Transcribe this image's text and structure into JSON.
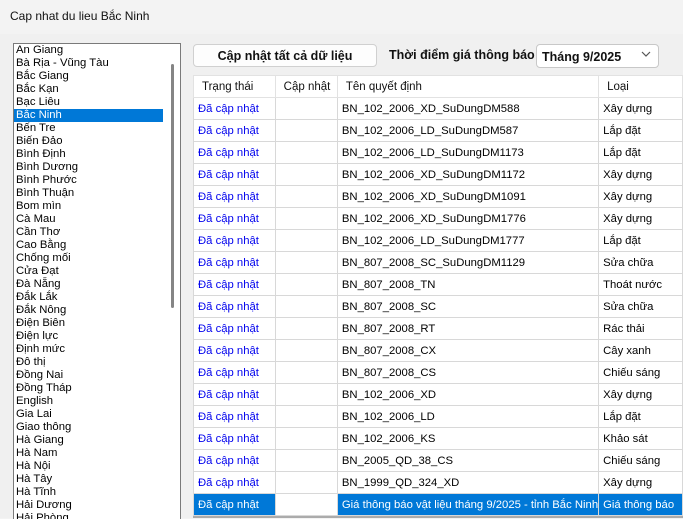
{
  "window": {
    "title": "Cap nhat du lieu Bắc Ninh"
  },
  "provinces": {
    "selected_index": 5,
    "items": [
      "An Giang",
      "Bà Rịa - Vũng Tàu",
      "Bắc Giang",
      "Bắc Kạn",
      "Bạc Liêu",
      "Bắc Ninh",
      "Bến Tre",
      "Biến Đảo",
      "Bình Định",
      "Bình Dương",
      "Bình Phước",
      "Bình Thuận",
      "Bom mìn",
      "Cà Mau",
      "Cần Thơ",
      "Cao Bằng",
      "Chống mối",
      "Cửa Đạt",
      "Đà Nẵng",
      "Đắk Lắk",
      "Đắk Nông",
      "Điện Biên",
      "Điện lực",
      "Định mức",
      "Đô thị",
      "Đồng Nai",
      "Đồng Tháp",
      "English",
      "Gia Lai",
      "Giao thông",
      "Hà Giang",
      "Hà Nam",
      "Hà Nội",
      "Hà Tây",
      "Hà Tĩnh",
      "Hải Dương",
      "Hải Phòng"
    ]
  },
  "toolbar": {
    "update_all_label": "Cập nhật tất cả dữ liệu",
    "notify_label": "Thời điểm giá thông báo",
    "month_value": "Tháng 9/2025"
  },
  "grid": {
    "columns": [
      "Trạng thái",
      "Cập nhật",
      "Tên quyết định",
      "Loại"
    ],
    "selected_row": 18,
    "rows": [
      {
        "status": "Đã cập nhật",
        "update": "",
        "name": "BN_102_2006_XD_SuDungDM588",
        "type": "Xây dựng"
      },
      {
        "status": "Đã cập nhật",
        "update": "",
        "name": "BN_102_2006_LD_SuDungDM587",
        "type": "Lắp đặt"
      },
      {
        "status": "Đã cập nhật",
        "update": "",
        "name": "BN_102_2006_LD_SuDungDM1173",
        "type": "Lắp đặt"
      },
      {
        "status": "Đã cập nhật",
        "update": "",
        "name": "BN_102_2006_XD_SuDungDM1172",
        "type": "Xây dựng"
      },
      {
        "status": "Đã cập nhật",
        "update": "",
        "name": "BN_102_2006_XD_SuDungDM1091",
        "type": "Xây dựng"
      },
      {
        "status": "Đã cập nhật",
        "update": "",
        "name": "BN_102_2006_XD_SuDungDM1776",
        "type": "Xây dựng"
      },
      {
        "status": "Đã cập nhật",
        "update": "",
        "name": "BN_102_2006_LD_SuDungDM1777",
        "type": "Lắp đặt"
      },
      {
        "status": "Đã cập nhật",
        "update": "",
        "name": "BN_807_2008_SC_SuDungDM1129",
        "type": "Sửa chữa"
      },
      {
        "status": "Đã cập nhật",
        "update": "",
        "name": "BN_807_2008_TN",
        "type": "Thoát nước"
      },
      {
        "status": "Đã cập nhật",
        "update": "",
        "name": "BN_807_2008_SC",
        "type": "Sửa chữa"
      },
      {
        "status": "Đã cập nhật",
        "update": "",
        "name": "BN_807_2008_RT",
        "type": "Rác thải"
      },
      {
        "status": "Đã cập nhật",
        "update": "",
        "name": "BN_807_2008_CX",
        "type": "Cây xanh"
      },
      {
        "status": "Đã cập nhật",
        "update": "",
        "name": "BN_807_2008_CS",
        "type": "Chiếu sáng"
      },
      {
        "status": "Đã cập nhật",
        "update": "",
        "name": "BN_102_2006_XD",
        "type": "Xây dựng"
      },
      {
        "status": "Đã cập nhật",
        "update": "",
        "name": "BN_102_2006_LD",
        "type": "Lắp đặt"
      },
      {
        "status": "Đã cập nhật",
        "update": "",
        "name": "BN_102_2006_KS",
        "type": "Khảo sát"
      },
      {
        "status": "Đã cập nhật",
        "update": "",
        "name": "BN_2005_QD_38_CS",
        "type": "Chiếu sáng"
      },
      {
        "status": "Đã cập nhật",
        "update": "",
        "name": "BN_1999_QD_324_XD",
        "type": "Xây dựng"
      },
      {
        "status": "Đã cập nhật",
        "update": "",
        "name": "Giá thông báo vật liệu tháng 9/2025 - tỉnh Bắc Ninh",
        "type": "Giá thông báo"
      }
    ]
  },
  "colors": {
    "selection": "#0078d7",
    "status_link": "#0000ee"
  }
}
